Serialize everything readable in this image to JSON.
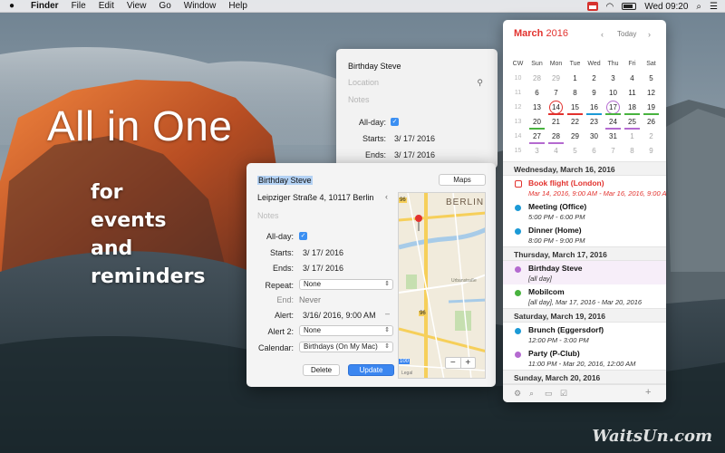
{
  "menubar": {
    "app_name": "Finder",
    "items": [
      "File",
      "Edit",
      "View",
      "Go",
      "Window",
      "Help"
    ],
    "clock": "Wed 09:20"
  },
  "promo": {
    "headline": "All in One",
    "lines": [
      "for",
      "events",
      "and",
      "reminders"
    ]
  },
  "back_popover": {
    "title": "Birthday Steve",
    "location_placeholder": "Location",
    "notes_placeholder": "Notes",
    "allday_label": "All-day:",
    "starts_label": "Starts:",
    "starts_value": "3/ 17/ 2016",
    "ends_label": "Ends:",
    "ends_value": "3/ 17/ 2016"
  },
  "event_popover": {
    "title": "Birthday Steve",
    "maps_button": "Maps",
    "address": "Leipziger Straße 4, 10117 Berlin",
    "notes_placeholder": "Notes",
    "allday_label": "All-day:",
    "starts_label": "Starts:",
    "starts_value": "3/ 17/ 2016",
    "ends_label": "Ends:",
    "ends_value": "3/ 17/ 2016",
    "repeat_label": "Repeat:",
    "repeat_value": "None",
    "end_label": "End:",
    "end_value": "Never",
    "alert_label": "Alert:",
    "alert_value": "3/16/ 2016,   9:00 AM",
    "alert2_label": "Alert 2:",
    "alert2_value": "None",
    "calendar_label": "Calendar:",
    "calendar_value": "Birthdays (On My Mac)",
    "delete_button": "Delete",
    "update_button": "Update",
    "map": {
      "city_label": "BERLIN",
      "road_labels": [
        "96",
        "96",
        "100",
        "Urbanstraße"
      ],
      "legal": "Legal",
      "zoom_out": "−",
      "zoom_in": "+"
    }
  },
  "calendar": {
    "month": "March",
    "year": "2016",
    "today_button": "Today",
    "prev": "‹",
    "next": "›",
    "weekday_headers": [
      "CW",
      "Sun",
      "Mon",
      "Tue",
      "Wed",
      "Thu",
      "Fri",
      "Sat"
    ],
    "weeks": [
      [
        "10",
        "28",
        "29",
        "1",
        "2",
        "3",
        "4",
        "5"
      ],
      [
        "11",
        "6",
        "7",
        "8",
        "9",
        "10",
        "11",
        "12"
      ],
      [
        "12",
        "13",
        "14",
        "15",
        "16",
        "17",
        "18",
        "19"
      ],
      [
        "13",
        "20",
        "21",
        "22",
        "23",
        "24",
        "25",
        "26"
      ],
      [
        "14",
        "27",
        "28",
        "29",
        "30",
        "31",
        "1",
        "2"
      ],
      [
        "15",
        "3",
        "4",
        "5",
        "6",
        "7",
        "8",
        "9"
      ]
    ],
    "days": [
      {
        "header": "Wednesday, March 16, 2016",
        "events": [
          {
            "name": "Book flight (London)",
            "time": "Mar 14, 2016, 9:00 AM - Mar 16, 2016, 9:00 AM",
            "color": "#e2322e",
            "kind": "reminder"
          },
          {
            "name": "Meeting (Office)",
            "time": "5:00 PM - 6:00 PM",
            "color": "#1c9ad6",
            "kind": "event"
          },
          {
            "name": "Dinner (Home)",
            "time": "8:00 PM - 9:00 PM",
            "color": "#1c9ad6",
            "kind": "event"
          }
        ]
      },
      {
        "header": "Thursday, March 17, 2016",
        "events": [
          {
            "name": "Birthday Steve",
            "time": "[all day]",
            "color": "#b46ad0",
            "kind": "event"
          },
          {
            "name": "Mobilcom",
            "time": "[all day], Mar 17, 2016 - Mar 20, 2016",
            "color": "#49b33f",
            "kind": "event"
          }
        ]
      },
      {
        "header": "Saturday, March 19, 2016",
        "events": [
          {
            "name": "Brunch (Eggersdorf)",
            "time": "12:00 PM - 3:00 PM",
            "color": "#1c9ad6",
            "kind": "event"
          },
          {
            "name": "Party (P-Club)",
            "time": "11:00 PM - Mar 20, 2016, 12:00 AM",
            "color": "#b46ad0",
            "kind": "event"
          }
        ]
      },
      {
        "header": "Sunday, March 20, 2016",
        "events": []
      }
    ],
    "footer_add": "+"
  },
  "watermark": "WaitsUn.com",
  "colors": {
    "accent_red": "#e2322e",
    "accent_blue": "#3b86f0",
    "purple": "#b46ad0",
    "green": "#49b33f",
    "cyan": "#1c9ad6"
  }
}
